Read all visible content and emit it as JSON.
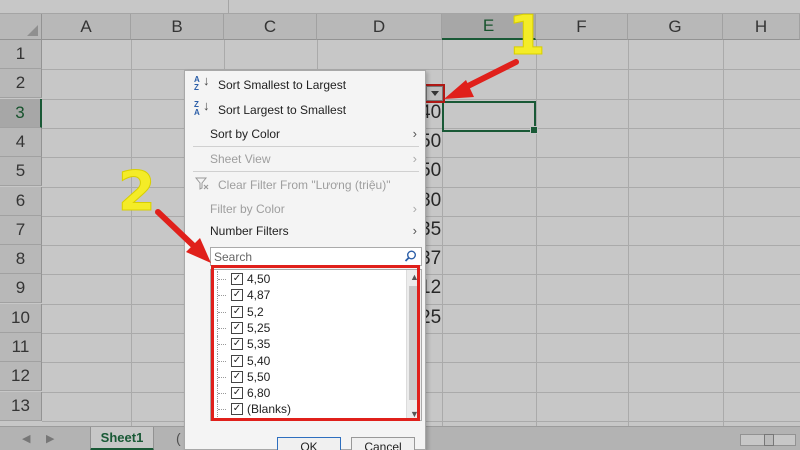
{
  "columns": [
    "A",
    "B",
    "C",
    "D",
    "E",
    "F",
    "G",
    "H"
  ],
  "rows": [
    "1",
    "2",
    "3",
    "4",
    "5",
    "6",
    "7",
    "8",
    "9",
    "10",
    "11",
    "12",
    "13"
  ],
  "active_column": "E",
  "active_row": "3",
  "partial_cells": [
    {
      "row": "2",
      "value": "›"
    },
    {
      "row": "3",
      "value": "40"
    },
    {
      "row": "4",
      "value": "50"
    },
    {
      "row": "5",
      "value": "50"
    },
    {
      "row": "6",
      "value": "80"
    },
    {
      "row": "7",
      "value": "35"
    },
    {
      "row": "8",
      "value": "37"
    },
    {
      "row": "9",
      "value": "12"
    },
    {
      "row": "10",
      "value": "25"
    }
  ],
  "menu": {
    "sort_asc": "Sort Smallest to Largest",
    "sort_desc": "Sort Largest to Smallest",
    "sort_color": "Sort by Color",
    "sheet_view": "Sheet View",
    "clear_filter": "Clear Filter From \"Lương (triệu)\"",
    "filter_color": "Filter by Color",
    "number_filters": "Number Filters",
    "search_placeholder": "Search",
    "submenu_glyph": "›"
  },
  "list": {
    "items": [
      "4,50",
      "4,87",
      "5,2",
      "5,25",
      "5,35",
      "5,40",
      "5,50",
      "6,80",
      "(Blanks)"
    ],
    "checked_glyph": "✓"
  },
  "buttons": {
    "ok": "OK",
    "cancel": "Cancel"
  },
  "tabs": {
    "sheet1": "Sheet1",
    "add": "("
  },
  "annotations": {
    "step1": "1",
    "step2": "2"
  },
  "colors": {
    "accent": "#217346",
    "annotation_red": "#e0201b",
    "annotation_yellow": "#f4ec27"
  },
  "icons": {
    "sort_asc": "sort-az-icon",
    "sort_desc": "sort-za-icon",
    "clear_filter": "clear-filter-icon",
    "search": "search-icon",
    "filter_arrow": "filter-dropdown-icon"
  }
}
